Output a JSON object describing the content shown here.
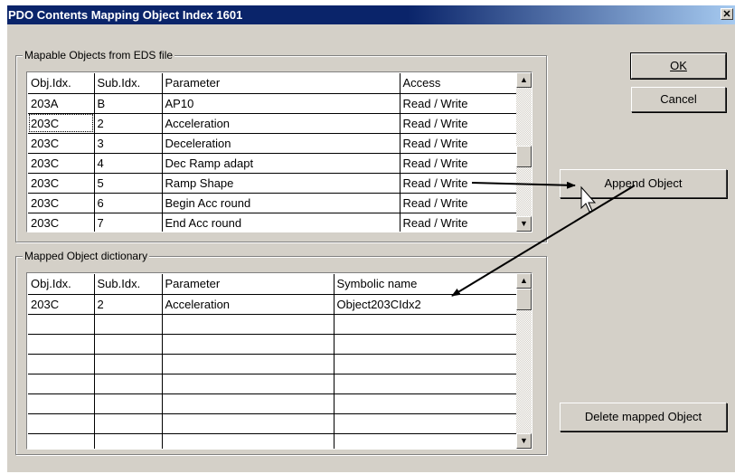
{
  "window": {
    "title": "PDO Contents Mapping Object Index 1601",
    "close_glyph": "✕"
  },
  "mapable": {
    "group_label": "Mapable Objects from EDS file",
    "headers": [
      "Obj.Idx.",
      "Sub.Idx.",
      "Parameter",
      "Access"
    ],
    "rows": [
      [
        "203A",
        "B",
        "AP10",
        "Read / Write"
      ],
      [
        "203C",
        "2",
        "Acceleration",
        "Read / Write"
      ],
      [
        "203C",
        "3",
        "Deceleration",
        "Read / Write"
      ],
      [
        "203C",
        "4",
        "Dec Ramp adapt",
        "Read / Write"
      ],
      [
        "203C",
        "5",
        "Ramp Shape",
        "Read / Write"
      ],
      [
        "203C",
        "6",
        "Begin Acc round",
        "Read / Write"
      ],
      [
        "203C",
        "7",
        "End Acc round",
        "Read / Write"
      ]
    ]
  },
  "mapped": {
    "group_label": "Mapped Object dictionary",
    "headers": [
      "Obj.Idx.",
      "Sub.Idx.",
      "Parameter",
      "Symbolic name"
    ],
    "rows": [
      [
        "203C",
        "2",
        "Acceleration",
        "Object203CIdx2"
      ],
      [
        "",
        "",
        "",
        ""
      ],
      [
        "",
        "",
        "",
        ""
      ],
      [
        "",
        "",
        "",
        ""
      ],
      [
        "",
        "",
        "",
        ""
      ],
      [
        "",
        "",
        "",
        ""
      ],
      [
        "",
        "",
        "",
        ""
      ],
      [
        "",
        "",
        "",
        ""
      ]
    ]
  },
  "buttons": {
    "ok": "OK",
    "cancel": "Cancel",
    "append": "Append Object",
    "delete": "Delete mapped Object"
  },
  "scroll": {
    "up_glyph": "▲",
    "down_glyph": "▼"
  }
}
